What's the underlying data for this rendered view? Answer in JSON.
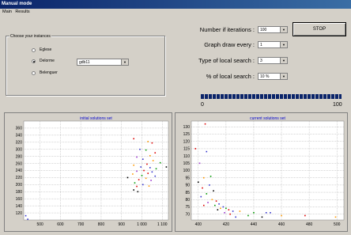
{
  "window": {
    "title": "Manual mode"
  },
  "menu": [
    "Main",
    "Results"
  ],
  "instances": {
    "group_title": "Choose your instances",
    "options": [
      "Eglese",
      "Delorme",
      "Belenguer"
    ],
    "selected": "Delorme",
    "instance_value": "gdb11"
  },
  "params": {
    "iterations": {
      "label": "Number if iterations :",
      "value": "100"
    },
    "graph_draw": {
      "label": "Graph draw every :",
      "value": "1"
    },
    "local_search_type": {
      "label": "Type of local search :",
      "value": "3"
    },
    "local_search_pct": {
      "label": "% of local search :",
      "value": "10 %"
    }
  },
  "stop_label": "STOP",
  "progress": {
    "value": 100,
    "min_label": "0",
    "max_label": "100"
  },
  "chart_data": [
    {
      "type": "scatter",
      "title": "initial solutions set",
      "xlim": [
        420,
        1130
      ],
      "ylim": [
        100,
        380
      ],
      "xticks": [
        "500",
        "600",
        "700",
        "800",
        "900",
        "1 000",
        "1 100"
      ],
      "yticks": [
        "120",
        "140",
        "160",
        "180",
        "200",
        "220",
        "240",
        "260",
        "280",
        "300",
        "320",
        "340",
        "360"
      ],
      "grid": true,
      "points": [
        {
          "x": 430,
          "y": 112,
          "c": "#3333cc"
        },
        {
          "x": 440,
          "y": 102,
          "c": "#3333cc"
        },
        {
          "x": 960,
          "y": 330,
          "c": "#dd0000"
        },
        {
          "x": 1030,
          "y": 322,
          "c": "#ff9900"
        },
        {
          "x": 1050,
          "y": 318,
          "c": "#dd0000"
        },
        {
          "x": 990,
          "y": 300,
          "c": "#3333cc"
        },
        {
          "x": 1020,
          "y": 298,
          "c": "#009900"
        },
        {
          "x": 1065,
          "y": 290,
          "c": "#dd0000"
        },
        {
          "x": 1040,
          "y": 282,
          "c": "#ff9900"
        },
        {
          "x": 975,
          "y": 278,
          "c": "#9933cc"
        },
        {
          "x": 1005,
          "y": 272,
          "c": "#3333cc"
        },
        {
          "x": 1055,
          "y": 268,
          "c": "#ff9900"
        },
        {
          "x": 1090,
          "y": 262,
          "c": "#009900"
        },
        {
          "x": 1025,
          "y": 258,
          "c": "#dd0000"
        },
        {
          "x": 960,
          "y": 255,
          "c": "#ff9900"
        },
        {
          "x": 995,
          "y": 250,
          "c": "#3333cc"
        },
        {
          "x": 1040,
          "y": 248,
          "c": "#3333cc"
        },
        {
          "x": 1070,
          "y": 245,
          "c": "#009900"
        },
        {
          "x": 1120,
          "y": 250,
          "c": "#000000"
        },
        {
          "x": 1010,
          "y": 240,
          "c": "#dd0000"
        },
        {
          "x": 975,
          "y": 238,
          "c": "#9933cc"
        },
        {
          "x": 1050,
          "y": 236,
          "c": "#3333cc"
        },
        {
          "x": 1030,
          "y": 232,
          "c": "#dd0000"
        },
        {
          "x": 955,
          "y": 230,
          "c": "#ff9900"
        },
        {
          "x": 1000,
          "y": 226,
          "c": "#009900"
        },
        {
          "x": 1065,
          "y": 224,
          "c": "#3333cc"
        },
        {
          "x": 930,
          "y": 220,
          "c": "#000000"
        },
        {
          "x": 1020,
          "y": 218,
          "c": "#ff9900"
        },
        {
          "x": 985,
          "y": 214,
          "c": "#dd0000"
        },
        {
          "x": 1045,
          "y": 212,
          "c": "#9933cc"
        },
        {
          "x": 965,
          "y": 205,
          "c": "#009900"
        },
        {
          "x": 1005,
          "y": 200,
          "c": "#3333cc"
        },
        {
          "x": 975,
          "y": 195,
          "c": "#dd0000"
        },
        {
          "x": 1035,
          "y": 196,
          "c": "#ff9900"
        },
        {
          "x": 960,
          "y": 185,
          "c": "#000000"
        },
        {
          "x": 980,
          "y": 180,
          "c": "#000000"
        }
      ]
    },
    {
      "type": "scatter",
      "title": "current solutions set",
      "xlim": [
        395,
        505
      ],
      "ylim": [
        66,
        134
      ],
      "xticks": [
        "400",
        "420",
        "440",
        "460",
        "480",
        "500"
      ],
      "yticks": [
        "70",
        "75",
        "80",
        "85",
        "90",
        "95",
        "100",
        "105",
        "110",
        "115",
        "120",
        "125",
        "130"
      ],
      "grid": true,
      "points": [
        {
          "x": 405,
          "y": 132,
          "c": "#dd0000"
        },
        {
          "x": 398,
          "y": 115,
          "c": "#dd0000"
        },
        {
          "x": 406,
          "y": 113,
          "c": "#3333cc"
        },
        {
          "x": 401,
          "y": 105,
          "c": "#9933cc"
        },
        {
          "x": 404,
          "y": 95,
          "c": "#ff9900"
        },
        {
          "x": 409,
          "y": 96,
          "c": "#009900"
        },
        {
          "x": 400,
          "y": 92,
          "c": "#000000"
        },
        {
          "x": 408,
          "y": 90,
          "c": "#3333cc"
        },
        {
          "x": 403,
          "y": 88,
          "c": "#dd0000"
        },
        {
          "x": 411,
          "y": 86,
          "c": "#000000"
        },
        {
          "x": 406,
          "y": 84,
          "c": "#009900"
        },
        {
          "x": 402,
          "y": 82,
          "c": "#3333cc"
        },
        {
          "x": 410,
          "y": 80,
          "c": "#ff9900"
        },
        {
          "x": 413,
          "y": 79,
          "c": "#dd0000"
        },
        {
          "x": 407,
          "y": 78,
          "c": "#9933cc"
        },
        {
          "x": 415,
          "y": 77,
          "c": "#3333cc"
        },
        {
          "x": 412,
          "y": 76,
          "c": "#009900"
        },
        {
          "x": 404,
          "y": 76,
          "c": "#dd0000"
        },
        {
          "x": 418,
          "y": 75,
          "c": "#3333cc"
        },
        {
          "x": 416,
          "y": 74,
          "c": "#ff9900"
        },
        {
          "x": 420,
          "y": 74,
          "c": "#009900"
        },
        {
          "x": 422,
          "y": 73,
          "c": "#dd0000"
        },
        {
          "x": 414,
          "y": 73,
          "c": "#000000"
        },
        {
          "x": 425,
          "y": 72,
          "c": "#3333cc"
        },
        {
          "x": 419,
          "y": 71,
          "c": "#9933cc"
        },
        {
          "x": 430,
          "y": 72,
          "c": "#ff9900"
        },
        {
          "x": 440,
          "y": 71,
          "c": "#009900"
        },
        {
          "x": 449,
          "y": 71,
          "c": "#3333cc"
        },
        {
          "x": 452,
          "y": 71,
          "c": "#3333cc"
        },
        {
          "x": 423,
          "y": 70,
          "c": "#dd0000"
        },
        {
          "x": 436,
          "y": 69,
          "c": "#009900"
        },
        {
          "x": 446,
          "y": 68,
          "c": "#000000"
        },
        {
          "x": 460,
          "y": 69,
          "c": "#ff9900"
        },
        {
          "x": 477,
          "y": 69,
          "c": "#dd0000"
        },
        {
          "x": 499,
          "y": 68,
          "c": "#ff9900"
        },
        {
          "x": 427,
          "y": 68,
          "c": "#3333cc"
        }
      ]
    }
  ]
}
